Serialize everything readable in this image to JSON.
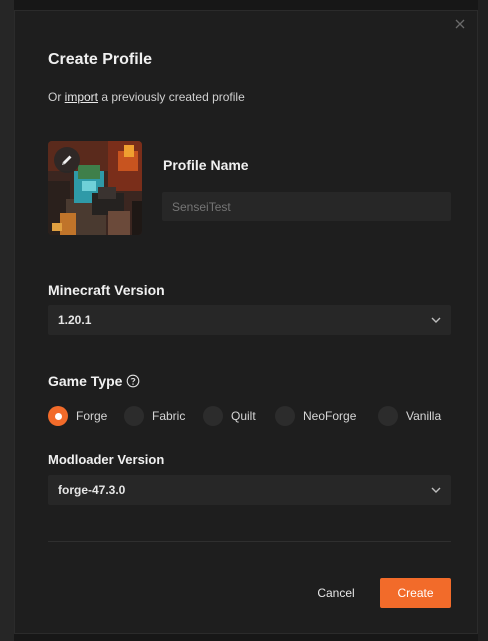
{
  "modal": {
    "title": "Create Profile",
    "import_prefix": "Or ",
    "import_link": "import",
    "import_suffix": " a previously created profile"
  },
  "profile": {
    "name_label": "Profile Name",
    "name_value": "SenseiTest",
    "avatar_icon": "pencil-icon"
  },
  "minecraft": {
    "label": "Minecraft Version",
    "selected": "1.20.1"
  },
  "game_type": {
    "label": "Game Type",
    "help_icon": "question-circle-icon",
    "options": [
      {
        "label": "Forge",
        "selected": true
      },
      {
        "label": "Fabric",
        "selected": false
      },
      {
        "label": "Quilt",
        "selected": false
      },
      {
        "label": "NeoForge",
        "selected": false
      },
      {
        "label": "Vanilla",
        "selected": false
      }
    ]
  },
  "modloader": {
    "label": "Modloader Version",
    "selected": "forge-47.3.0"
  },
  "actions": {
    "cancel_label": "Cancel",
    "create_label": "Create"
  },
  "colors": {
    "accent": "#f26b2a",
    "modal_bg": "#1e1e1e",
    "input_bg": "#272727"
  }
}
